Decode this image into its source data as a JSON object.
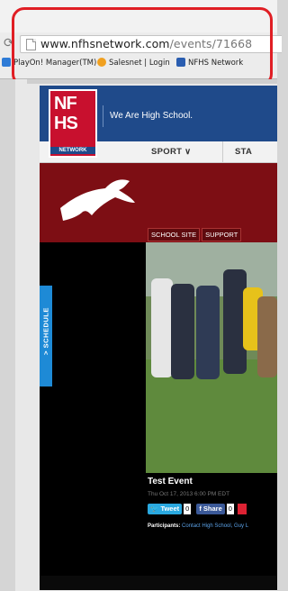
{
  "browser": {
    "url_domain": "www.nfhsnetwork.com",
    "url_path": "/events/71668",
    "bookmarks": [
      {
        "label": "PlayOn! Manager(TM)",
        "icon": "playon-icon",
        "color": "#2e7bd6"
      },
      {
        "label": "Salesnet | Login",
        "icon": "salesnet-icon",
        "color": "#f0a020"
      },
      {
        "label": "NFHS Network",
        "icon": "nfhs-icon",
        "color": "#2a5db0"
      }
    ]
  },
  "site": {
    "logo_line1": "NF",
    "logo_line2": "HS",
    "logo_line3": "NETWORK",
    "tagline": "We Are High School.",
    "nav": {
      "sport": "SPORT ∨",
      "state": "STA"
    },
    "banner_links": [
      "SCHOOL SITE",
      "SUPPORT"
    ],
    "schedule_tab": "> SCHEDULE",
    "event": {
      "title": "Test Event",
      "date": "Thu Oct 17, 2013 6:00 PM EDT"
    },
    "social": {
      "tweet": "Tweet",
      "tweet_count": "0",
      "share": "Share",
      "share_count": "0"
    },
    "participants_label": "Participants:",
    "participants_value": "Contact High School, Guy L"
  },
  "colors": {
    "highlight": "#e01e24",
    "nav_blue": "#1f4a8a",
    "banner_red": "#7d0e14",
    "schedule_blue": "#1e8ad6"
  }
}
